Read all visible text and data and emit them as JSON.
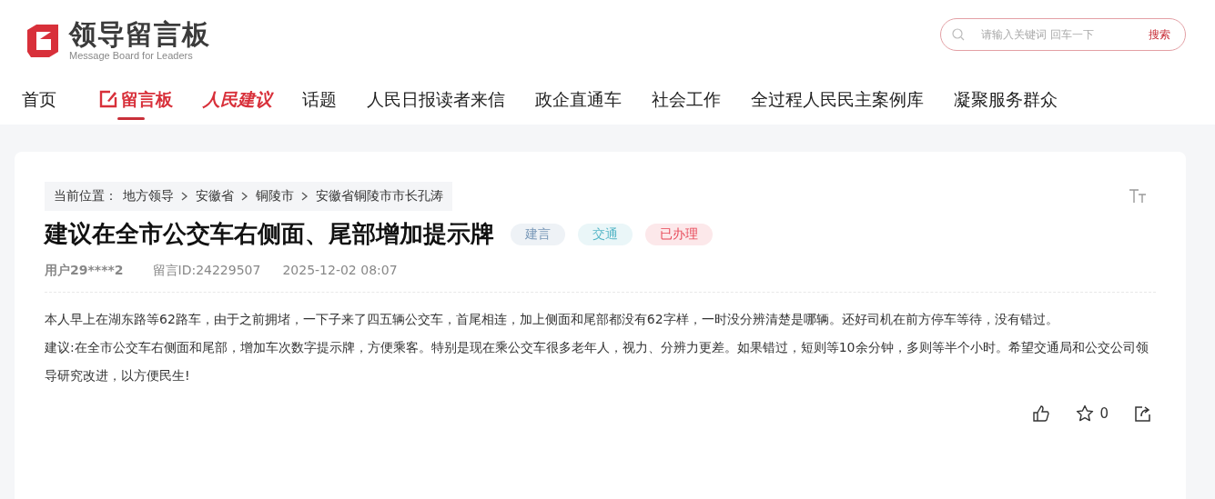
{
  "logo": {
    "title": "领导留言板",
    "subtitle": "Message Board for Leaders"
  },
  "search": {
    "placeholder": "请输入关键词 回车一下",
    "button": "搜索"
  },
  "nav": [
    {
      "label": "首页",
      "kind": "plain",
      "selected": false
    },
    {
      "label": "留言板",
      "kind": "icon",
      "selected": true
    },
    {
      "label": "人民建议",
      "kind": "brand",
      "selected": false
    },
    {
      "label": "话题",
      "kind": "plain",
      "selected": false
    },
    {
      "label": "人民日报读者来信",
      "kind": "plain",
      "selected": false
    },
    {
      "label": "政企直通车",
      "kind": "plain",
      "selected": false
    },
    {
      "label": "社会工作",
      "kind": "plain",
      "selected": false
    },
    {
      "label": "全过程人民民主案例库",
      "kind": "plain",
      "selected": false
    },
    {
      "label": "凝聚服务群众",
      "kind": "plain",
      "selected": false
    }
  ],
  "breadcrumb": {
    "prefix": "当前位置：",
    "items": [
      "地方领导",
      "安徽省",
      "铜陵市",
      "安徽省铜陵市市长孔涛"
    ]
  },
  "message": {
    "title": "建议在全市公交车右侧面、尾部增加提示牌",
    "tags": [
      {
        "label": "建言",
        "color": "#eef2f6"
      },
      {
        "label": "交通",
        "color": "#eaf6f8"
      },
      {
        "label": "已办理",
        "color": "#fce8ea"
      }
    ],
    "user": "用户29****2",
    "id": "留言ID:24229507",
    "time": "2025-12-02 08:07",
    "paragraphs": [
      "本人早上在湖东路等62路车，由于之前拥堵，一下子来了四五辆公交车，首尾相连，加上侧面和尾部都没有62字样，一时没分辨清楚是哪辆。还好司机在前方停车等待，没有错过。",
      "建议:在全市公交车右侧面和尾部，增加车次数字提示牌，方便乘客。特别是现在乘公交车很多老年人，视力、分辨力更差。如果错过，短则等10余分钟，多则等半个小时。希望交通局和公交公司领导研究改进，以方便民生!"
    ],
    "favorites": "0"
  }
}
